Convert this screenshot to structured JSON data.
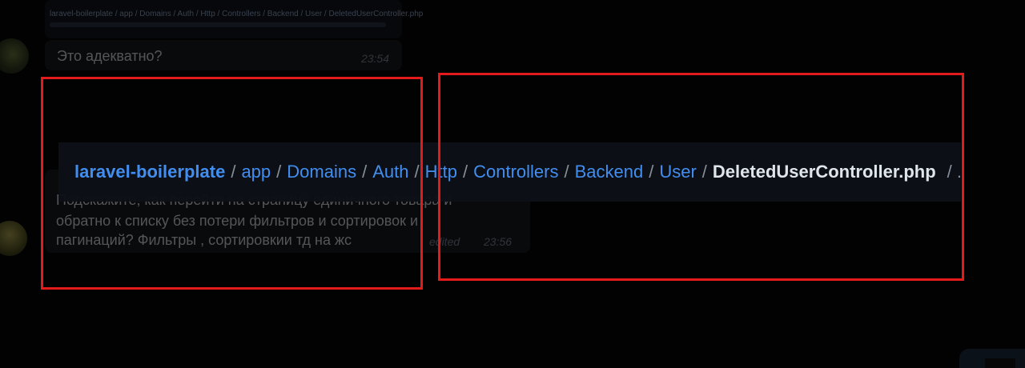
{
  "chat": {
    "quote": {
      "path": "laravel-boilerplate / app / Domains / Auth / Http / Controllers / Backend / User / DeletedUserController.php"
    },
    "message1": {
      "text": "Это адекватно?",
      "time": "23:54"
    },
    "message2": {
      "lines": [
        "Подскажите, как перейти на страницу единичного товара и",
        "обратно к списку без потери фильтров и сортировок и",
        "пагинаций? Фильтры , сортировкии тд на жс"
      ],
      "edited": "edited",
      "time": "23:56"
    }
  },
  "breadcrumb": {
    "repo": "laravel-boilerplate",
    "items": [
      "app",
      "Domains",
      "Auth",
      "Http",
      "Controllers",
      "Backend",
      "User"
    ],
    "current": "DeletedUserController.php",
    "separator": "/",
    "trailing": "/ ..."
  },
  "annotations": {
    "color": "#e31b1b"
  }
}
